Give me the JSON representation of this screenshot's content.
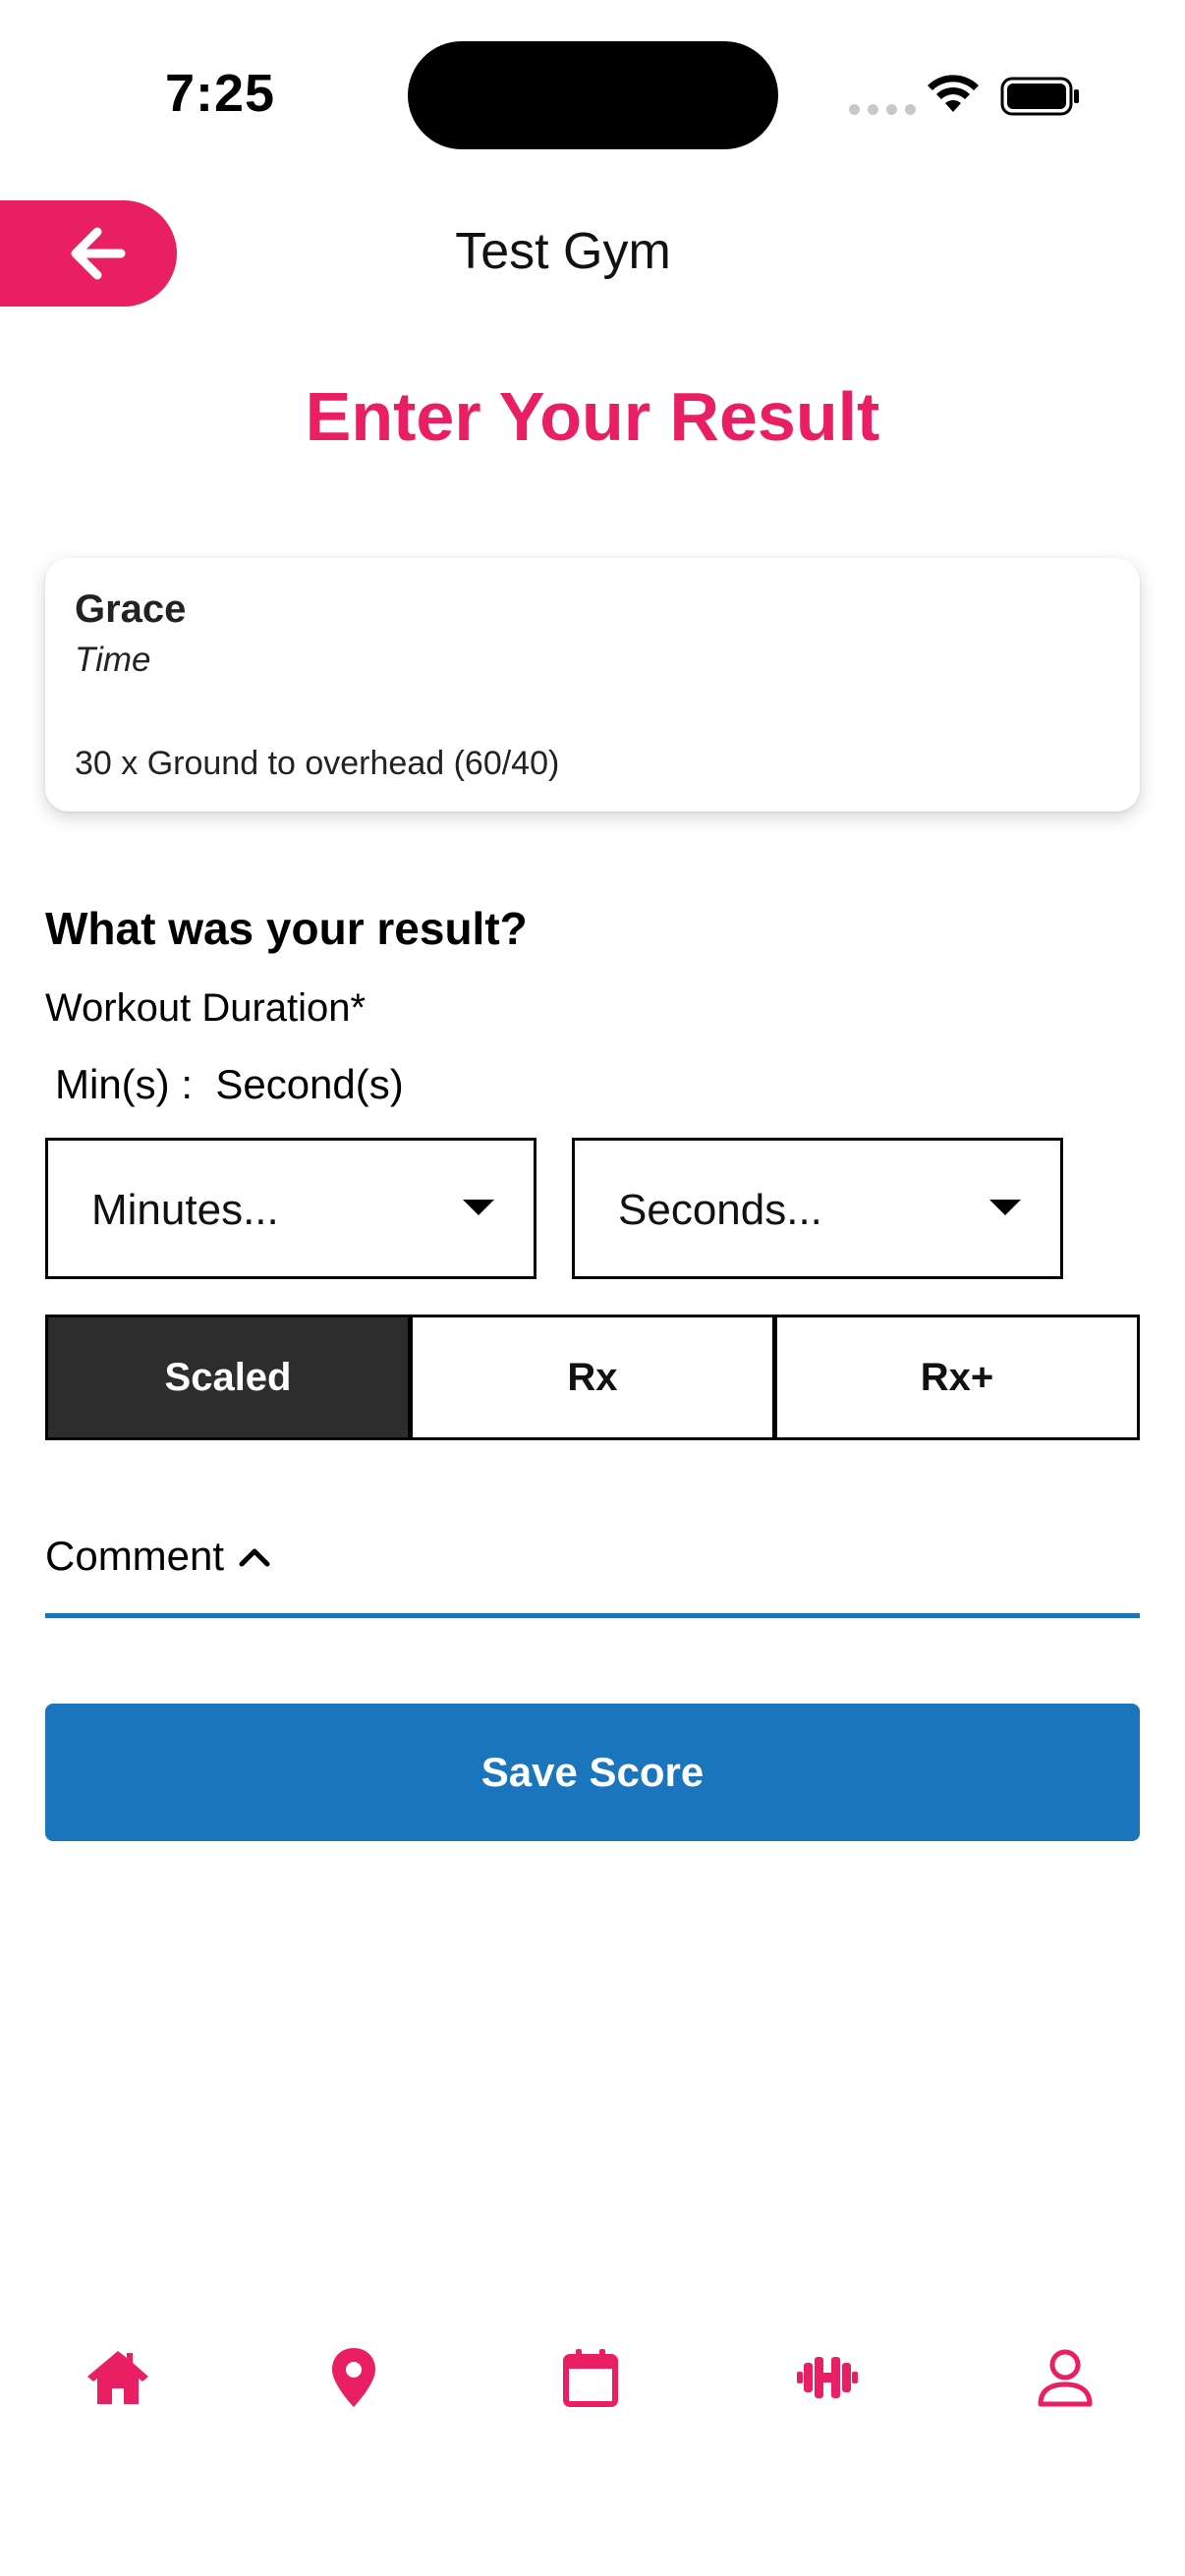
{
  "status_bar": {
    "time": "7:25"
  },
  "header": {
    "title": "Test Gym",
    "back_icon": "arrow-left-icon"
  },
  "page_title": "Enter Your Result",
  "workout": {
    "name": "Grace",
    "type": "Time",
    "description": "30 x Ground to overhead (60/40)"
  },
  "result": {
    "heading": "What was your result?",
    "duration_label": "Workout Duration*",
    "min_sec_label": "Min(s) :  Second(s)",
    "minutes_placeholder": "Minutes...",
    "seconds_placeholder": "Seconds..."
  },
  "scaling": {
    "options": [
      "Scaled",
      "Rx",
      "Rx+"
    ],
    "selected": "Scaled"
  },
  "comment": {
    "label": "Comment"
  },
  "save_button": {
    "label": "Save Score"
  },
  "bottom_nav": {
    "items": [
      "home-icon",
      "location-pin-icon",
      "calendar-icon",
      "dumbbell-icon",
      "user-icon"
    ]
  },
  "colors": {
    "accent": "#e91e63",
    "primary": "#1b75bc",
    "selected_segment": "#2d2d2d"
  }
}
